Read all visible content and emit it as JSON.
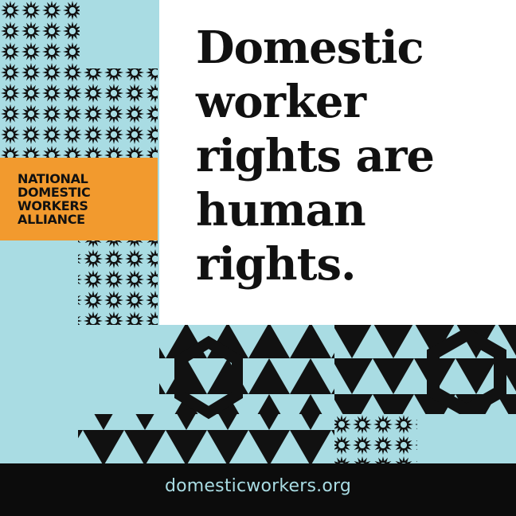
{
  "headline": "Domestic\nworker\nrights are\nhuman\nrights.",
  "logo": {
    "lines": [
      "NATIONAL",
      "DOMESTIC",
      "WORKERS",
      "ALLIANCE"
    ]
  },
  "footer": {
    "url": "domesticworkers.org"
  },
  "colors": {
    "background": "#a9dce3",
    "ink": "#111111",
    "accent": "#f29a2e",
    "footer": "#0c0c0c"
  }
}
